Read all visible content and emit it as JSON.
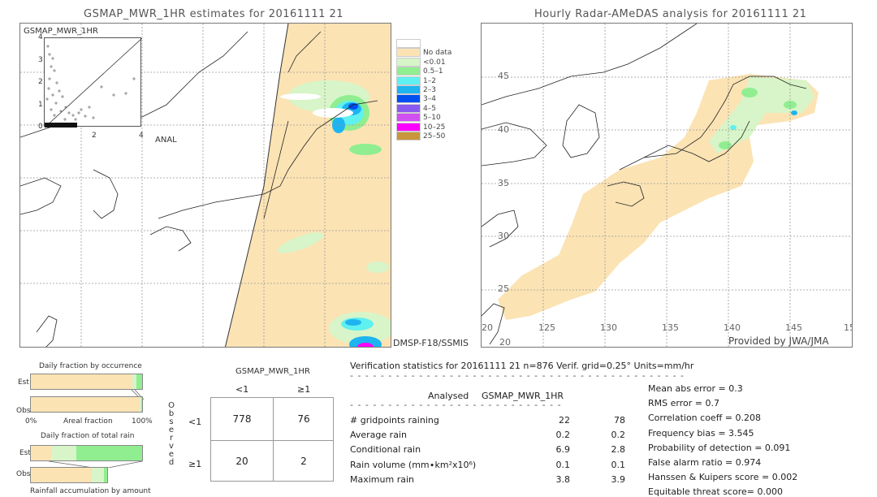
{
  "left_panel": {
    "title": "GSMAP_MWR_1HR estimates for 20161111 21",
    "scatter_label_y": "GSMAP_MWR_1HR",
    "scatter_label_x": "ANAL",
    "scatter_ticks": [
      "0",
      "1",
      "2",
      "3",
      "4"
    ],
    "scatter_x_ticks": [
      "2",
      "4"
    ],
    "satellite_label": "DMSP-F18/SSMIS"
  },
  "legend": {
    "items": [
      {
        "label": "",
        "color": "#ffffff"
      },
      {
        "label": "No data",
        "color": "#fbe3b4"
      },
      {
        "label": "<0.01",
        "color": "#d7f5c8"
      },
      {
        "label": "0.5–1",
        "color": "#90ee90"
      },
      {
        "label": "1–2",
        "color": "#5ff0f0"
      },
      {
        "label": "2–3",
        "color": "#1eb4f0"
      },
      {
        "label": "3–4",
        "color": "#0050f0"
      },
      {
        "label": "4–5",
        "color": "#8a5af0"
      },
      {
        "label": "5–10",
        "color": "#d050f0"
      },
      {
        "label": "10–25",
        "color": "#ff00ff"
      },
      {
        "label": "25–50",
        "color": "#c8963c"
      }
    ]
  },
  "right_panel": {
    "title": "Hourly Radar-AMeDAS analysis for 20161111 21",
    "lat_ticks": [
      "45",
      "40",
      "35",
      "30",
      "25",
      "20"
    ],
    "lon_ticks": [
      "20",
      "125",
      "130",
      "135",
      "140",
      "145",
      "15"
    ],
    "credit": "Provided by JWA/JMA"
  },
  "occurrence": {
    "title": "Daily fraction by occurrence",
    "est_label": "Est",
    "obs_label": "Obs",
    "axis_left": "0%",
    "axis_mid": "Areal fraction",
    "axis_right": "100%",
    "est_fractions": {
      "no_rain": 0.91,
      "light": 0.04,
      "moderate": 0.05
    },
    "obs_fractions": {
      "no_rain": 0.975,
      "light": 0.015,
      "moderate": 0.01
    }
  },
  "total_rain": {
    "title": "Daily fraction of total rain",
    "est_label": "Est",
    "obs_label": "Obs",
    "footer": "Rainfall accumulation by amount",
    "est_fractions": {
      "no_rain": 0.18,
      "light": 0.23,
      "moderate": 0.59
    },
    "obs_scale": 0.69,
    "obs_fractions": {
      "no_rain": 0.8,
      "light": 0.16,
      "moderate": 0.04
    }
  },
  "contingency": {
    "header": "GSMAP_MWR_1HR",
    "col_labels": [
      "<1",
      "≥1"
    ],
    "row_labels": [
      "<1",
      "≥1"
    ],
    "observed_label": [
      "O",
      "b",
      "s",
      "e",
      "r",
      "v",
      "e",
      "d"
    ],
    "cells": [
      [
        "778",
        "76"
      ],
      [
        "20",
        "2"
      ]
    ]
  },
  "verification": {
    "header": "Verification statistics for 20161111 21   n=876   Verif. grid=0.25°   Units=mm/hr",
    "dashes_long": "- - - - - - - - - - - - - - - - - - - - - - - - - - - - - - - - - - - - - - - - - - - - - -",
    "dashes_short": "- - - - - - - - - - - - - - - - - - - - - - - - - - - - - - - -",
    "col_analysed": "Analysed",
    "col_gsmap": "GSMAP_MWR_1HR",
    "rows": [
      {
        "label": "# gridpoints raining",
        "analysed": "22",
        "gsmap": "78"
      },
      {
        "label": "Average rain",
        "analysed": "0.2",
        "gsmap": "0.2"
      },
      {
        "label": "Conditional rain",
        "analysed": "6.9",
        "gsmap": "2.8"
      },
      {
        "label": "Rain volume (mm∙km²x10⁶)",
        "analysed": "0.1",
        "gsmap": "0.1"
      },
      {
        "label": "Maximum rain",
        "analysed": "3.8",
        "gsmap": "3.9"
      }
    ],
    "scores": [
      "Mean abs error = 0.3",
      "RMS error = 0.7",
      "Correlation coeff = 0.208",
      "Frequency bias = 3.545",
      "Probability of detection = 0.091",
      "False alarm ratio = 0.974",
      "Hanssen & Kuipers score = 0.002",
      "Equitable threat score= 0.000"
    ]
  }
}
